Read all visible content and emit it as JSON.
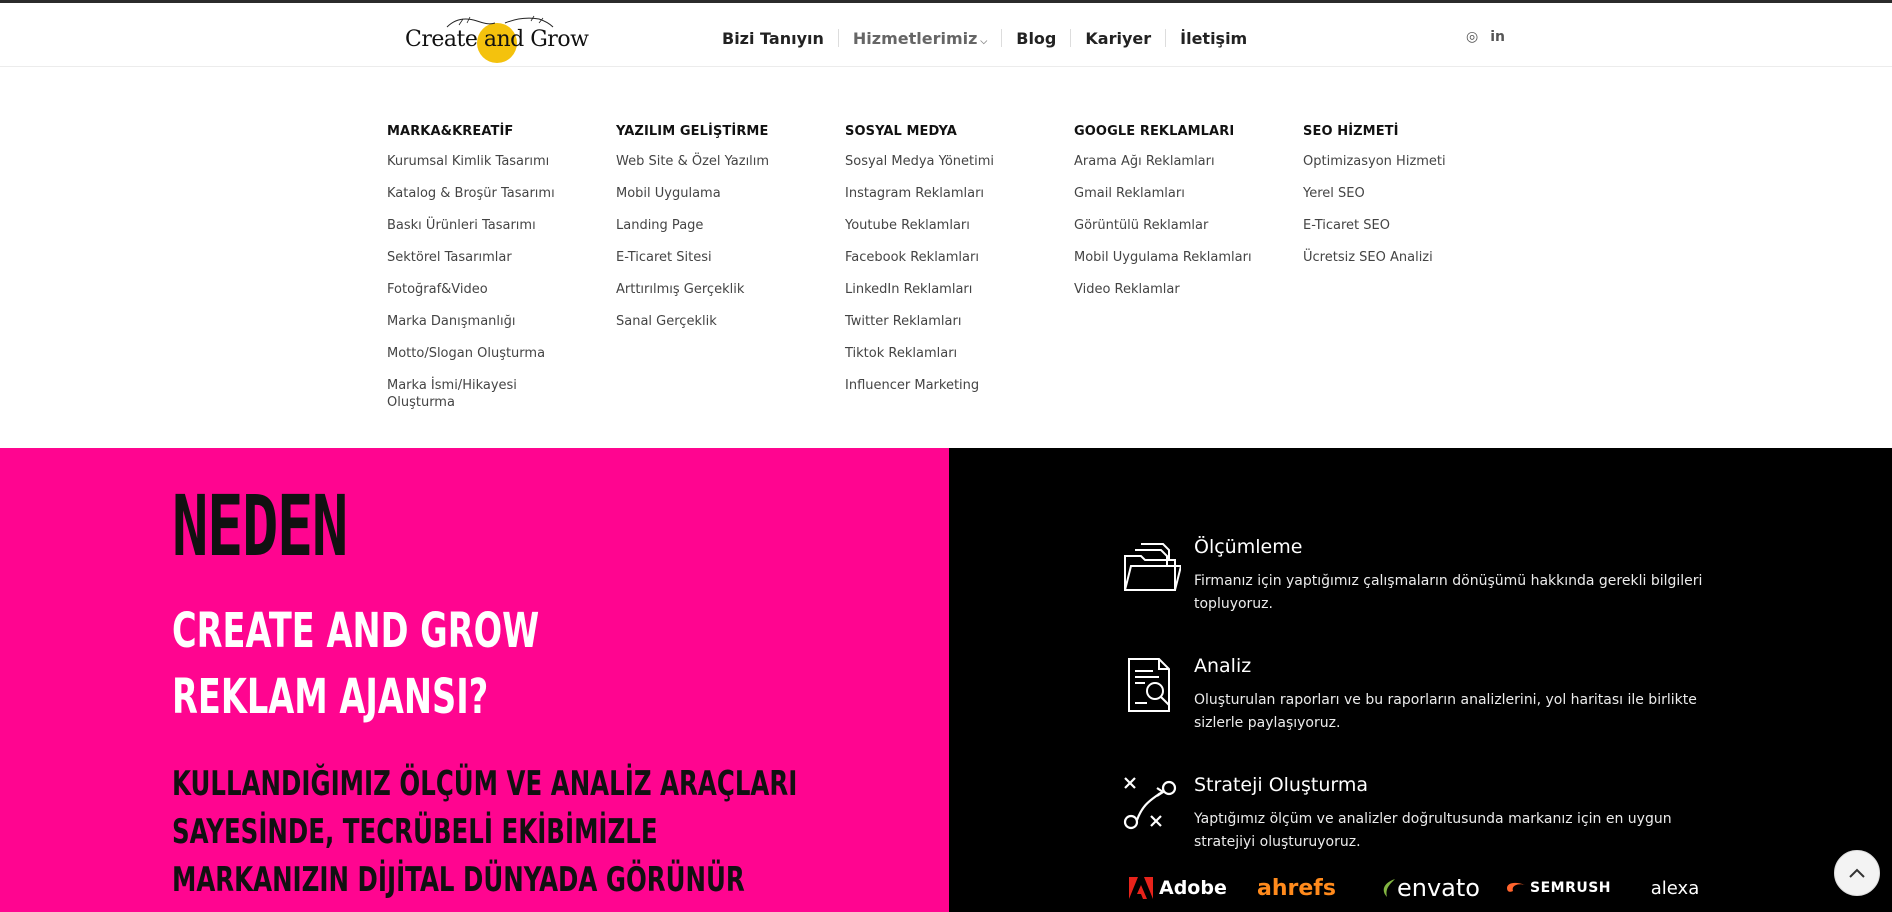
{
  "logo": {
    "text_create": "Create",
    "text_and": "and",
    "text_grow": "Grow"
  },
  "nav": {
    "items": [
      "Bizi Tanıyın",
      "Hizmetlerimiz",
      "Blog",
      "Kariyer",
      "İletişim"
    ]
  },
  "social": {
    "instagram": "◎",
    "linkedin": "in"
  },
  "mega_menu": {
    "columns": [
      {
        "title": "MARKA&KREATİF",
        "links": [
          "Kurumsal Kimlik Tasarımı",
          "Katalog & Broşür Tasarımı",
          "Baskı Ürünleri Tasarımı",
          "Sektörel Tasarımlar",
          "Fotoğraf&Video",
          "Marka Danışmanlığı",
          "Motto/Slogan Oluşturma",
          "Marka İsmi/Hikayesi Oluşturma"
        ]
      },
      {
        "title": "YAZILIM GELİŞTİRME",
        "links": [
          "Web Site & Özel Yazılım",
          "Mobil Uygulama",
          "Landing Page",
          "E-Ticaret Sitesi",
          "Arttırılmış Gerçeklik",
          "Sanal Gerçeklik"
        ]
      },
      {
        "title": "SOSYAL MEDYA",
        "links": [
          "Sosyal Medya Yönetimi",
          "Instagram Reklamları",
          "Youtube Reklamları",
          "Facebook Reklamları",
          "LinkedIn Reklamları",
          "Twitter Reklamları",
          "Tiktok Reklamları",
          "Influencer Marketing"
        ]
      },
      {
        "title": "GOOGLE REKLAMLARI",
        "links": [
          "Arama Ağı Reklamları",
          "Gmail Reklamları",
          "Görüntülü Reklamlar",
          "Mobil Uygulama Reklamları",
          "Video Reklamlar"
        ]
      },
      {
        "title": "SEO HİZMETİ",
        "links": [
          "Optimizasyon Hizmeti",
          "Yerel SEO",
          "E-Ticaret SEO",
          "Ücretsiz SEO Analizi"
        ]
      }
    ]
  },
  "hero": {
    "neden": "NEDEN",
    "line1": "CREATE AND GROW",
    "line2": "REKLAM AJANSI?",
    "sub1": "KULLANDIĞIMIZ ÖLÇÜM VE ANALİZ ARAÇLARI",
    "sub2": "SAYESİNDE, TECRÜBELİ EKİBİMİZLE",
    "sub3": "MARKANIZIN DİJİTAL DÜNYADA GÖRÜNÜR"
  },
  "features": [
    {
      "title": "Ölçümleme",
      "text": "Firmanız için yaptığımız çalışmaların dönüşümü hakkında gerekli bilgileri topluyoruz.",
      "icon": "folder-documents-icon"
    },
    {
      "title": "Analiz",
      "text": "Oluşturulan raporları ve bu raporların analizlerini, yol haritası ile birlikte sizlerle paylaşıyoruz.",
      "icon": "report-magnifier-icon"
    },
    {
      "title": "Strateji Oluşturma",
      "text": "Yaptığımız ölçüm ve analizler doğrultusunda markanız için en uygun stratejiyi oluşturuyoruz.",
      "icon": "strategy-path-icon"
    }
  ],
  "brands": [
    "Adobe",
    "ahrefs",
    "envato",
    "SEMRUSH",
    "alexa"
  ],
  "colors": {
    "pink": "#ff0590",
    "dark": "#000000",
    "sun": "#f4c20d"
  }
}
